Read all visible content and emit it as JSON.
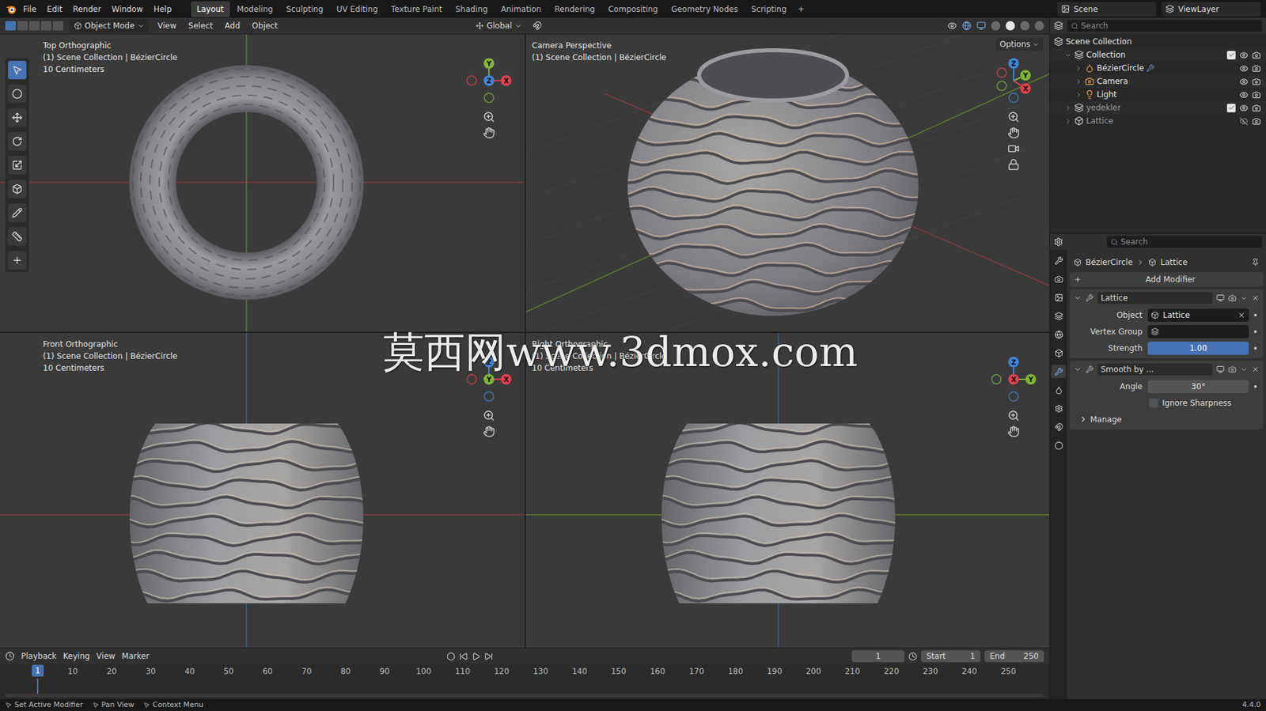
{
  "topbar": {
    "menus": [
      "File",
      "Edit",
      "Render",
      "Window",
      "Help"
    ],
    "workspaces": [
      {
        "label": "Layout",
        "selected": true
      },
      {
        "label": "Modeling",
        "selected": false
      },
      {
        "label": "Sculpting",
        "selected": false
      },
      {
        "label": "UV Editing",
        "selected": false
      },
      {
        "label": "Texture Paint",
        "selected": false
      },
      {
        "label": "Shading",
        "selected": false
      },
      {
        "label": "Animation",
        "selected": false
      },
      {
        "label": "Rendering",
        "selected": false
      },
      {
        "label": "Compositing",
        "selected": false
      },
      {
        "label": "Geometry Nodes",
        "selected": false
      },
      {
        "label": "Scripting",
        "selected": false
      }
    ],
    "add_tab": "+",
    "scene": "Scene",
    "view_layer": "ViewLayer"
  },
  "header": {
    "mode": "Object Mode",
    "menus": [
      "View",
      "Select",
      "Add",
      "Object"
    ],
    "orientation": "Global",
    "options": "Options"
  },
  "viewports": [
    {
      "kind": "top",
      "name": "Top Orthographic",
      "collection": "(1) Scene Collection | BézierCircle",
      "scale": "10 Centimeters",
      "axes": [
        {
          "label": "X",
          "color": "#e0424f"
        },
        {
          "label": "Y",
          "color": "#7fb43a"
        },
        {
          "label": "Z",
          "color": "#3f86d8"
        }
      ]
    },
    {
      "kind": "camera",
      "name": "Camera Perspective",
      "collection": "(1) Scene Collection | BézierCircle",
      "scale": "",
      "axes": [
        {
          "label": "X",
          "color": "#e0424f"
        },
        {
          "label": "Y",
          "color": "#7fb43a"
        },
        {
          "label": "Z",
          "color": "#3f86d8"
        }
      ]
    },
    {
      "kind": "front",
      "name": "Front Orthographic",
      "collection": "(1) Scene Collection | BézierCircle",
      "scale": "10 Centimeters",
      "axes": [
        {
          "label": "X",
          "color": "#e0424f"
        },
        {
          "label": "Y",
          "color": "#7fb43a"
        },
        {
          "label": "Z",
          "color": "#3f86d8"
        }
      ]
    },
    {
      "kind": "right",
      "name": "Right Orthographic",
      "collection": "(1) Scene Collection | BézierCircle",
      "scale": "10 Centimeters",
      "axes": [
        {
          "label": "X",
          "color": "#e0424f"
        },
        {
          "label": "Y",
          "color": "#7fb43a"
        },
        {
          "label": "Z",
          "color": "#3f86d8"
        }
      ]
    }
  ],
  "watermark": "莫西网www.3dmox.com",
  "outliner": {
    "search": "Search",
    "items": [
      {
        "label": "Scene Collection",
        "kind": "root",
        "indent": 0,
        "expanded": true
      },
      {
        "label": "Collection",
        "kind": "collection",
        "indent": 1,
        "expanded": true,
        "checked": true,
        "visible": true
      },
      {
        "label": "BézierCircle",
        "kind": "curve",
        "indent": 2,
        "expanded": false,
        "visible": true
      },
      {
        "label": "Camera",
        "kind": "camera",
        "indent": 2,
        "expanded": false,
        "visible": true
      },
      {
        "label": "Light",
        "kind": "light",
        "indent": 2,
        "expanded": false,
        "visible": true
      },
      {
        "label": "yedekler",
        "kind": "collection",
        "indent": 1,
        "expanded": false,
        "checked": true,
        "visible": true
      },
      {
        "label": "Lattice",
        "kind": "lattice",
        "indent": 1,
        "expanded": false,
        "visible": false
      }
    ]
  },
  "properties": {
    "search": "Search",
    "breadcrumb": [
      "BézierCircle",
      "Lattice"
    ],
    "add_modifier": "Add Modifier",
    "modifiers": [
      {
        "name": "Lattice",
        "expanded": true,
        "fields": [
          {
            "kind": "object",
            "label": "Object",
            "value": "Lattice"
          },
          {
            "kind": "group",
            "label": "Vertex Group",
            "value": ""
          },
          {
            "kind": "slider",
            "label": "Strength",
            "value": "1.00",
            "level": 1
          }
        ]
      },
      {
        "name": "Smooth by ...",
        "expanded": true,
        "fields": [
          {
            "kind": "number",
            "label": "Angle",
            "value": "30°"
          },
          {
            "kind": "checkbox",
            "label": "Ignore Sharpness",
            "checked": false
          },
          {
            "kind": "subpanel",
            "label": "Manage",
            "expanded": false
          }
        ]
      }
    ]
  },
  "timeline": {
    "menus": [
      "Playback",
      "Keying",
      "View",
      "Marker"
    ],
    "current_frame": "1",
    "start_label": "Start",
    "start": "1",
    "end_label": "End",
    "end": "250",
    "ticks": [
      "10",
      "20",
      "30",
      "40",
      "50",
      "60",
      "70",
      "80",
      "90",
      "100",
      "110",
      "120",
      "130",
      "140",
      "150",
      "160",
      "170",
      "180",
      "190",
      "200",
      "210",
      "220",
      "230",
      "240",
      "250"
    ]
  },
  "status_bar": {
    "items": [
      "Set Active Modifier",
      "Pan View",
      "Context Menu"
    ],
    "version": "4.4.0"
  }
}
